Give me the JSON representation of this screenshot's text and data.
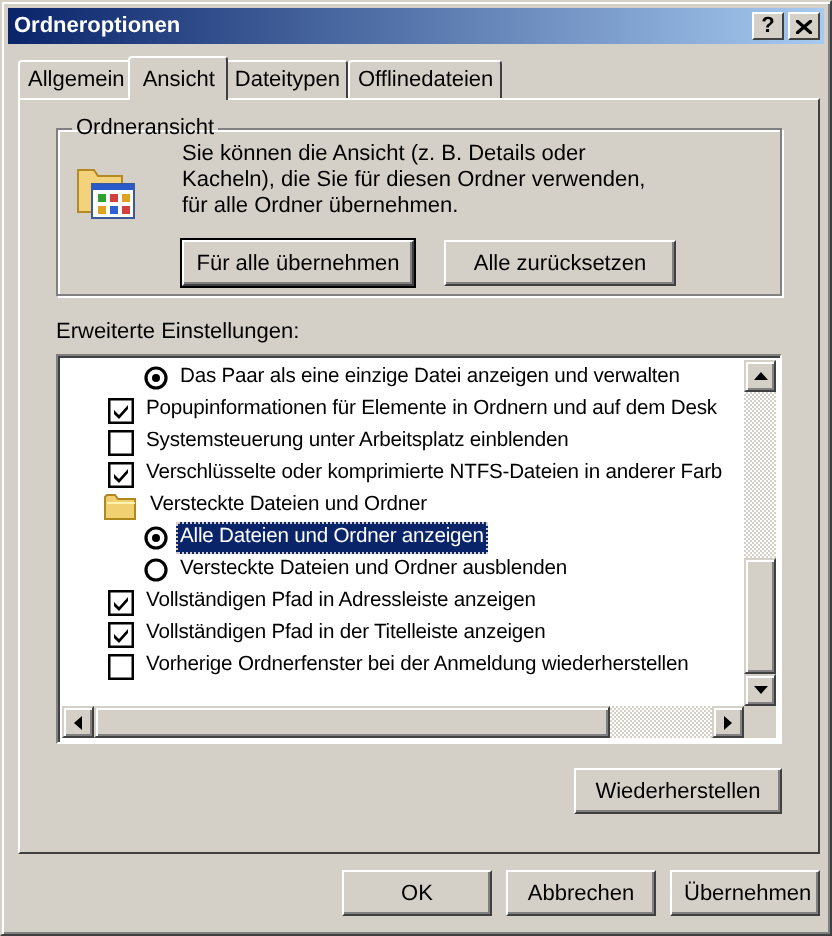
{
  "window": {
    "title": "Ordneroptionen",
    "help_button": "?"
  },
  "tabs": [
    {
      "label": "Allgemein",
      "selected": false
    },
    {
      "label": "Ansicht",
      "selected": true
    },
    {
      "label": "Dateitypen",
      "selected": false
    },
    {
      "label": "Offlinedateien",
      "selected": false
    }
  ],
  "folder_view": {
    "title": "Ordneransicht",
    "description": "Sie können die Ansicht (z. B. Details oder Kacheln), die Sie für diesen Ordner verwenden, für alle Ordner übernehmen.",
    "buttons": [
      {
        "label": "Für alle übernehmen",
        "default": true
      },
      {
        "label": "Alle zurücksetzen",
        "default": false
      }
    ]
  },
  "advanced": {
    "label": "Erweiterte Einstellungen:",
    "items": [
      {
        "kind": "radio",
        "label": "Das Paar als eine einzige Datei anzeigen und verwalten",
        "checked": true,
        "selected": false
      },
      {
        "kind": "checkbox",
        "label": "Popupinformationen für Elemente in Ordnern und auf dem Desk",
        "checked": true,
        "selected": false
      },
      {
        "kind": "checkbox",
        "label": "Systemsteuerung unter Arbeitsplatz einblenden",
        "checked": false,
        "selected": false
      },
      {
        "kind": "checkbox",
        "label": "Verschlüsselte oder komprimierte NTFS-Dateien in anderer Farb",
        "checked": true,
        "selected": false
      },
      {
        "kind": "folder",
        "label": "Versteckte Dateien und Ordner",
        "selected": false
      },
      {
        "kind": "radio",
        "label": "Alle Dateien und Ordner anzeigen",
        "checked": true,
        "selected": true
      },
      {
        "kind": "radio",
        "label": "Versteckte Dateien und Ordner ausblenden",
        "checked": false,
        "selected": false
      },
      {
        "kind": "checkbox",
        "label": "Vollständigen Pfad in Adressleiste anzeigen",
        "checked": true,
        "selected": false
      },
      {
        "kind": "checkbox",
        "label": "Vollständigen Pfad in der Titelleiste anzeigen",
        "checked": true,
        "selected": false
      },
      {
        "kind": "checkbox",
        "label": "Vorherige Ordnerfenster bei der Anmeldung wiederherstellen",
        "checked": false,
        "selected": false
      }
    ],
    "restore_button": "Wiederherstellen"
  },
  "buttons": [
    "OK",
    "Abbrechen",
    "Übernehmen"
  ]
}
